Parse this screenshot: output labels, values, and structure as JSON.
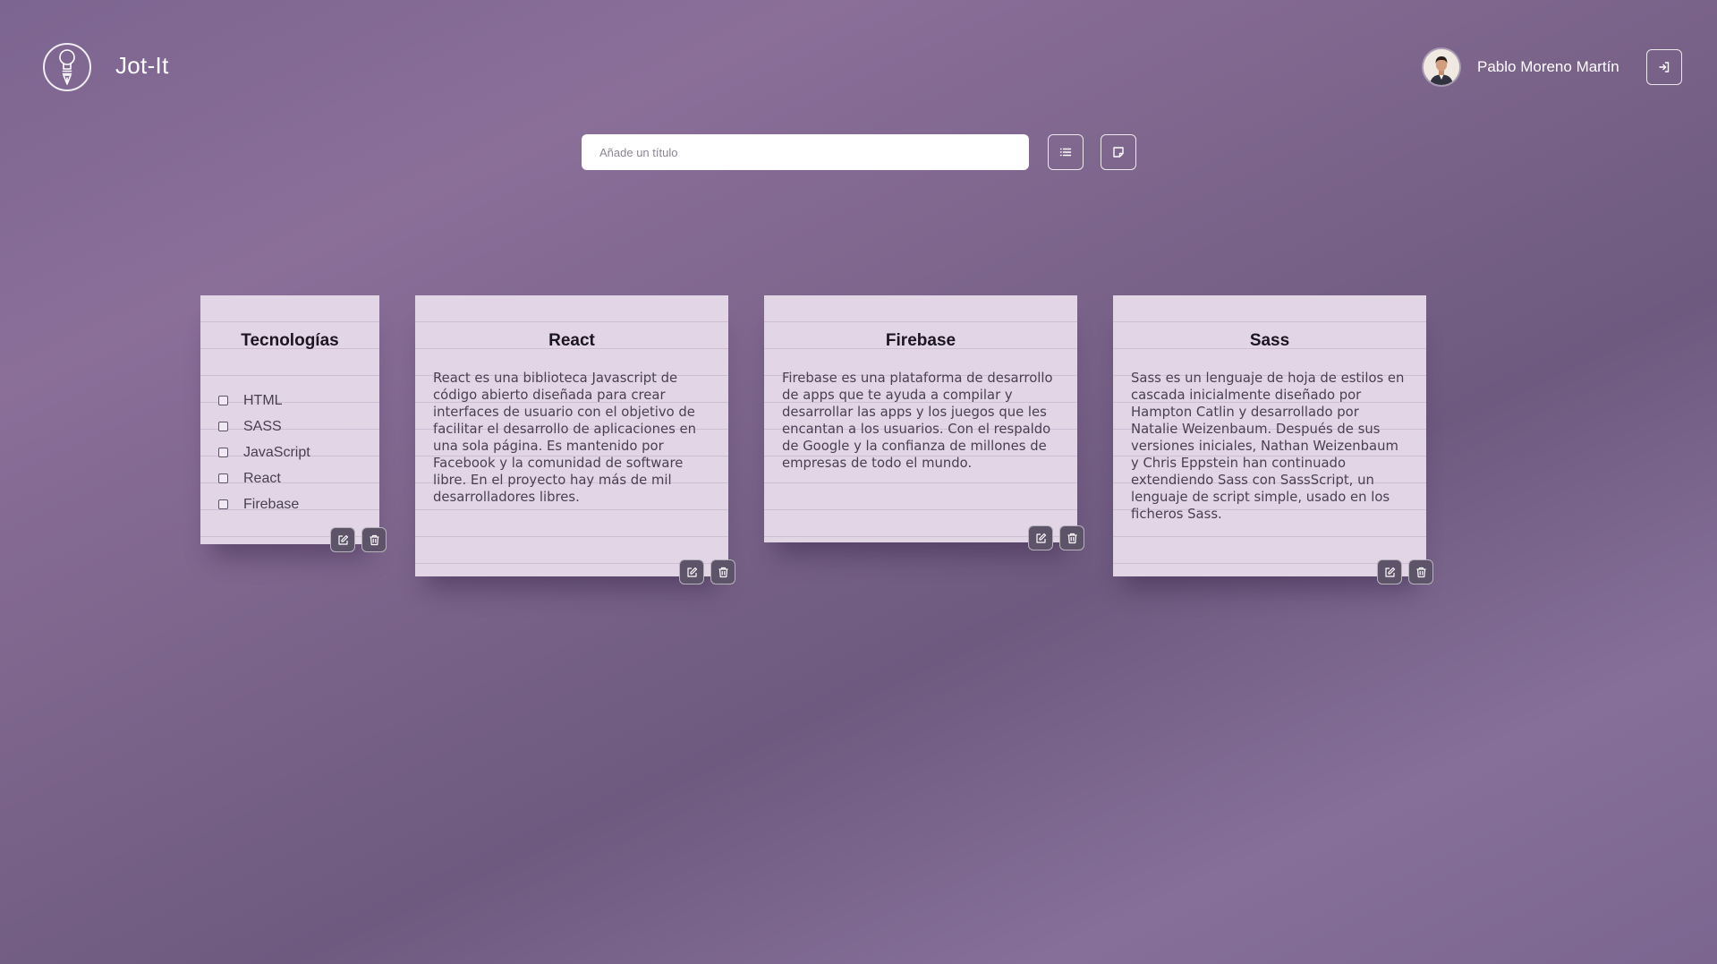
{
  "header": {
    "app_title": "Jot-It",
    "logo_icon": "lightbulb-pen-icon",
    "user_name": "Pablo Moreno Martín",
    "logout_icon": "sign-in-arrow-icon"
  },
  "toolbar": {
    "title_placeholder": "Añade un título",
    "list_icon": "list-icon",
    "note_icon": "sticky-note-icon"
  },
  "notes": [
    {
      "title": "Tecnologías",
      "type": "checklist",
      "items": [
        "HTML",
        "SASS",
        "JavaScript",
        "React",
        "Firebase"
      ],
      "edit_icon": "edit-icon",
      "delete_icon": "trash-icon"
    },
    {
      "title": "React",
      "type": "text",
      "text": "React es una biblioteca Javascript de código abierto diseñada para crear interfaces de usuario con el objetivo de facilitar el desarrollo de aplicaciones en una sola página. Es mantenido por Facebook y la comunidad de software libre. En el proyecto hay más de mil desarrolladores libres.",
      "edit_icon": "edit-icon",
      "delete_icon": "trash-icon"
    },
    {
      "title": "Firebase",
      "type": "text",
      "text": "Firebase es una plataforma de desarrollo de apps que te ayuda a compilar y desarrollar las apps y los juegos que les encantan a los usuarios. Con el respaldo de Google y la confianza de millones de empresas de todo el mundo.",
      "edit_icon": "edit-icon",
      "delete_icon": "trash-icon"
    },
    {
      "title": "Sass",
      "type": "text",
      "text": "Sass es un lenguaje de hoja de estilos en cascada inicialmente diseñado por Hampton Catlin y desarrollado por Natalie Weizenbaum. Después de sus versiones iniciales, Nathan Weizenbaum y Chris Eppstein han continuado extendiendo Sass con SassScript, un lenguaje de script simple, usado en los ficheros Sass.",
      "edit_icon": "edit-icon",
      "delete_icon": "trash-icon"
    }
  ],
  "colors": {
    "background": "#7c6590",
    "note_paper": "#e2d5e6",
    "note_button": "#5d546a",
    "text_light": "#ffffff"
  }
}
